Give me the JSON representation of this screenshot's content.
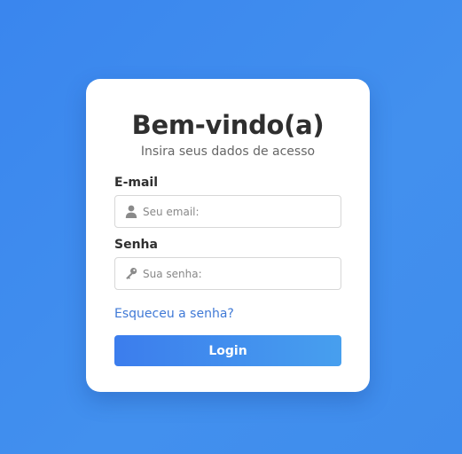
{
  "login": {
    "title": "Bem-vindo(a)",
    "subtitle": "Insira seus dados de acesso",
    "email": {
      "label": "E-mail",
      "placeholder": "Seu email:",
      "value": "",
      "icon": "user-icon"
    },
    "password": {
      "label": "Senha",
      "placeholder": "Sua senha:",
      "value": "",
      "icon": "key-icon"
    },
    "forgot_link": "Esqueceu a senha?",
    "submit_label": "Login"
  },
  "colors": {
    "background": "#3f8cec",
    "card": "#ffffff",
    "link": "#3f79d6",
    "button_start": "#3c7ded",
    "button_end": "#479fee"
  }
}
